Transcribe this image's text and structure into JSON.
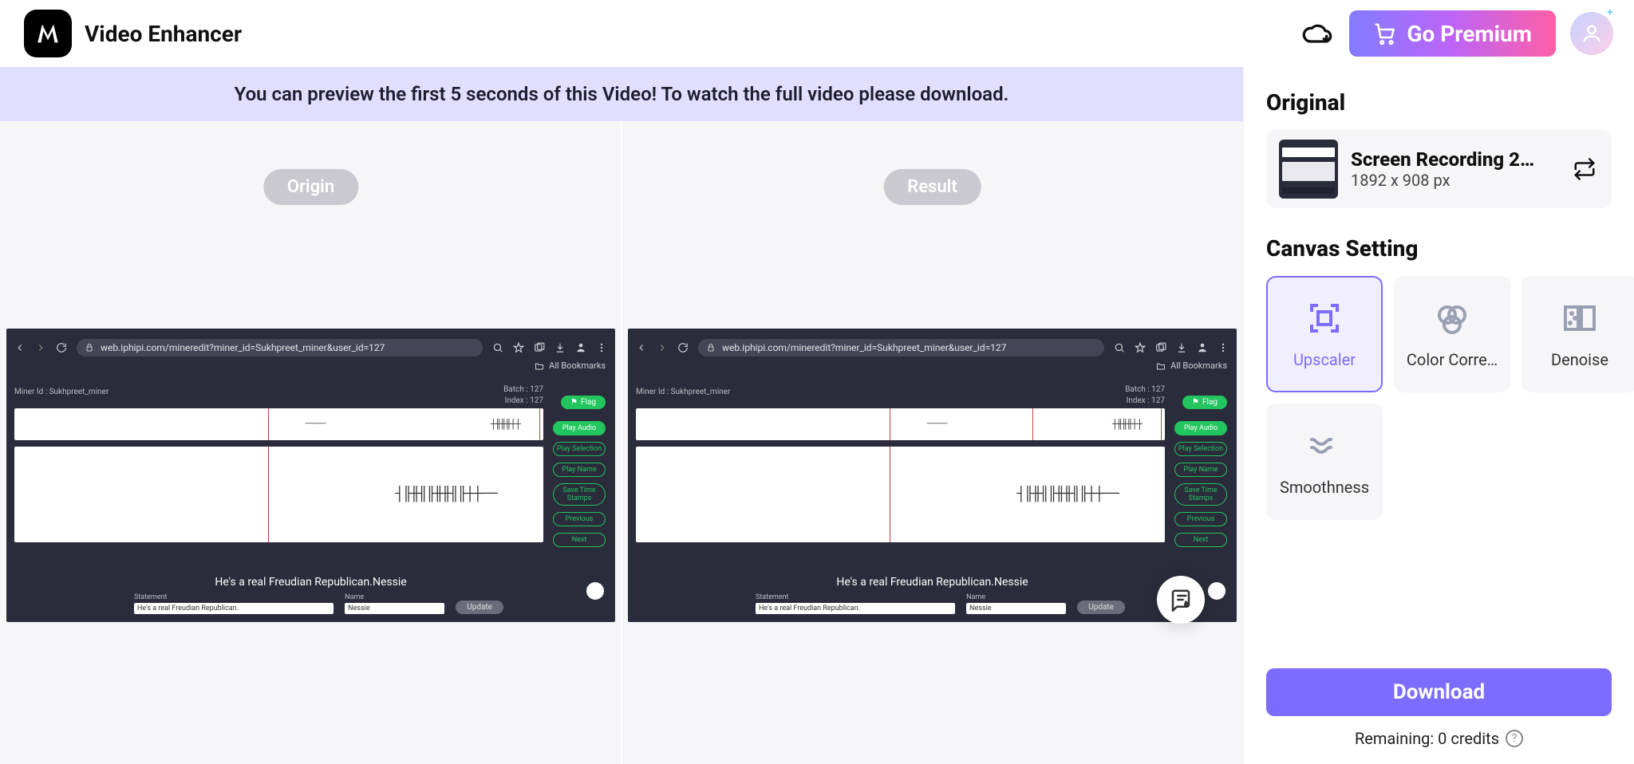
{
  "app_title": "Video Enhancer",
  "go_premium": "Go Premium",
  "banner": "You can preview the first 5 seconds of this Video! To watch the full video please download.",
  "compare": {
    "origin_label": "Origin",
    "result_label": "Result"
  },
  "preview": {
    "url": "web.iphipi.com/mineredit?miner_id=Sukhpreet_miner&user_id=127",
    "all_bookmarks": "All Bookmarks",
    "miner_id_label": "Miner Id : Sukhpreet_miner",
    "batch_label": "Batch : 127",
    "index_label": "Index : 127",
    "flag": "Flag",
    "side_buttons": [
      "Play Audio",
      "Play Selection",
      "Play Name",
      "Save Time Stamps",
      "Previous",
      "Next"
    ],
    "caption": "He's a real Freudian Republican.Nessie",
    "form": {
      "statement_label": "Statement",
      "statement_value": "He's a real Freudian Republican.",
      "name_label": "Name",
      "name_value": "Nessie",
      "update": "Update"
    }
  },
  "right": {
    "original_heading": "Original",
    "file_name": "Screen Recording 202…",
    "file_dim": "1892 x 908 px",
    "canvas_heading": "Canvas Setting",
    "settings": [
      {
        "key": "upscaler",
        "label": "Upscaler",
        "selected": true
      },
      {
        "key": "color",
        "label": "Color Corre…",
        "selected": false
      },
      {
        "key": "denoise",
        "label": "Denoise",
        "selected": false
      },
      {
        "key": "smoothness",
        "label": "Smoothness",
        "selected": false
      }
    ],
    "download": "Download",
    "remaining": "Remaining: 0 credits"
  }
}
